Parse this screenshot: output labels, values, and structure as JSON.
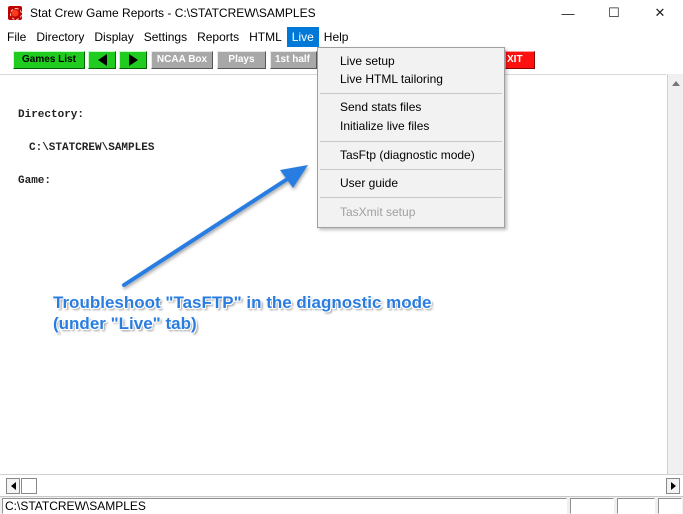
{
  "window": {
    "title": "Stat Crew Game Reports - C:\\STATCREW\\SAMPLES",
    "minimize_glyph": "—",
    "maximize_glyph": "☐",
    "close_glyph": "✕"
  },
  "menubar": {
    "items": [
      "File",
      "Directory",
      "Display",
      "Settings",
      "Reports",
      "HTML",
      "Live",
      "Help"
    ],
    "active": "Live"
  },
  "toolbar": {
    "games_list": "Games List",
    "ncaa_box": "NCAA Box",
    "plays": "Plays",
    "first_half": "1st half",
    "exit": "XIT",
    "colors": {
      "green": "#1fcc1f",
      "gray": "#a8a8a8",
      "red": "#ff1010"
    }
  },
  "content": {
    "directory_label": "Directory:",
    "directory_value": "C:\\STATCREW\\SAMPLES",
    "game_label": "Game:"
  },
  "live_menu": {
    "items": [
      {
        "label": "Live setup",
        "enabled": true
      },
      {
        "label": "Live HTML tailoring",
        "enabled": true
      },
      {
        "label": "Send stats files",
        "enabled": true
      },
      {
        "label": "Initialize live files",
        "enabled": true
      },
      {
        "label": "TasFtp (diagnostic mode)",
        "enabled": true
      },
      {
        "label": "User guide",
        "enabled": true
      },
      {
        "label": "TasXmit setup",
        "enabled": false
      }
    ]
  },
  "annotation": {
    "line1": "Troubleshoot \"TasFTP\" in the diagnostic mode",
    "line2": "(under \"Live\" tab)",
    "color": "#2a7de0"
  },
  "statusbar": {
    "path": "C:\\STATCREW\\SAMPLES"
  }
}
